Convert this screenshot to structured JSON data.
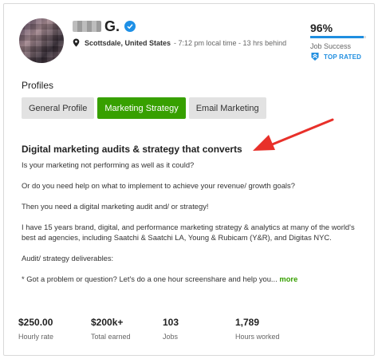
{
  "profile": {
    "name_initial": "G.",
    "location": "Scottsdale, United States",
    "local_time": "- 7:12 pm local time - 13 hrs behind"
  },
  "job_success": {
    "percent_text": "96%",
    "fraction": 0.96,
    "label": "Job Success",
    "badge": "TOP RATED"
  },
  "profiles": {
    "label": "Profiles",
    "tabs": [
      {
        "label": "General Profile",
        "active": false
      },
      {
        "label": "Marketing Strategy",
        "active": true
      },
      {
        "label": "Email Marketing",
        "active": false
      }
    ]
  },
  "overview": {
    "title": "Digital marketing audits & strategy that converts",
    "paragraphs": [
      "Is your marketing not performing as well as it could?",
      "Or do you need help on what to implement to achieve your revenue/ growth goals?",
      "Then you need a digital marketing audit and/ or strategy!",
      "I have 15 years brand, digital, and performance marketing strategy & analytics at many of the world's best ad agencies, including Saatchi & Saatchi LA, Young & Rubicam (Y&R), and Digitas NYC.",
      "Audit/ strategy deliverables:",
      "* Got a problem or question? Let's do a one hour screenshare and help you..."
    ],
    "more_label": "more"
  },
  "stats": [
    {
      "value": "$250.00",
      "label": "Hourly rate"
    },
    {
      "value": "$200k+",
      "label": "Total earned"
    },
    {
      "value": "103",
      "label": "Jobs"
    },
    {
      "value": "1,789",
      "label": "Hours worked"
    }
  ],
  "colors": {
    "accent_green": "#37a000",
    "accent_blue": "#1f8ee0",
    "arrow_red": "#e8302a"
  },
  "icons": {
    "verified": "verified-check-icon",
    "location": "map-pin-icon",
    "top_rated": "top-rated-badge-icon",
    "annotation": "red-arrow-icon"
  }
}
